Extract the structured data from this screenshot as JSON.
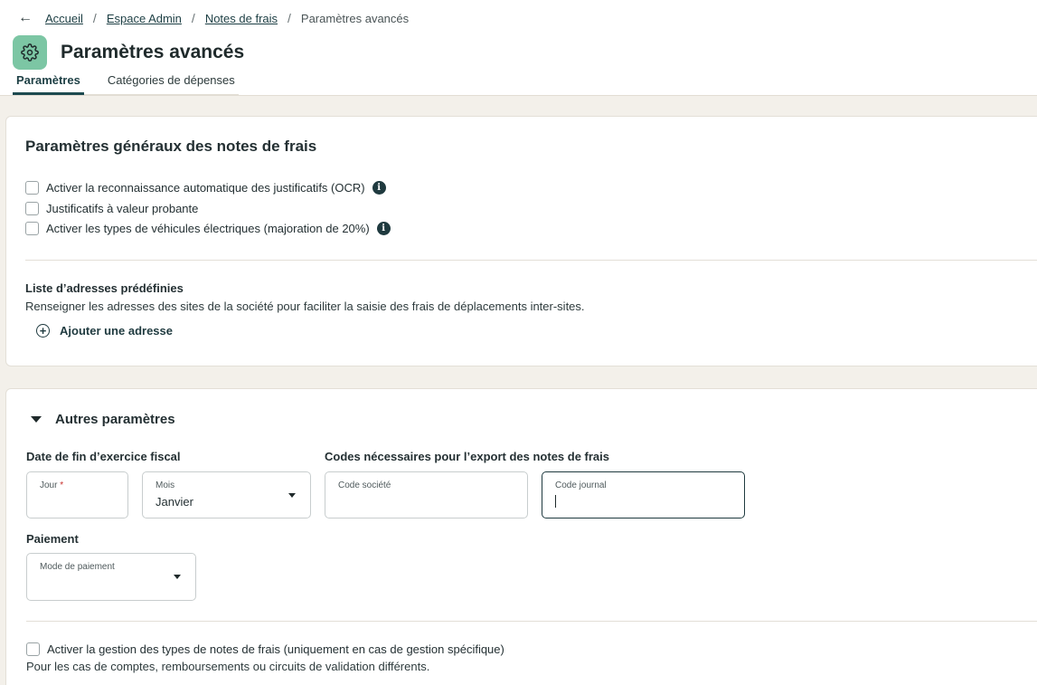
{
  "breadcrumb": {
    "back_icon": "arrow-left-icon",
    "items": [
      "Accueil",
      "Espace Admin",
      "Notes de frais"
    ],
    "current": "Paramètres avancés"
  },
  "header": {
    "icon": "gear-icon",
    "icon_bg": "#7cc6a4",
    "title": "Paramètres avancés"
  },
  "tabs": [
    {
      "label": "Paramètres",
      "active": true
    },
    {
      "label": "Catégories de dépenses",
      "active": false
    }
  ],
  "general": {
    "title": "Paramètres généraux des notes de frais",
    "options": [
      {
        "label": "Activer la reconnaissance automatique des justificatifs (OCR)",
        "checked": false,
        "info": true
      },
      {
        "label": "Justificatifs à valeur probante",
        "checked": false,
        "info": false
      },
      {
        "label": "Activer les types de véhicules électriques (majoration de 20%)",
        "checked": false,
        "info": true
      }
    ],
    "addresses": {
      "title": "Liste d’adresses prédéfinies",
      "description": "Renseigner les adresses des sites de la société pour faciliter la saisie des frais de déplacements inter-sites.",
      "add_label": "Ajouter une adresse"
    }
  },
  "other": {
    "title": "Autres paramètres",
    "fiscal": {
      "title": "Date de fin d’exercice fiscal",
      "day_label": "Jour",
      "day_required": "*",
      "day_value": "",
      "month_label": "Mois",
      "month_value": "Janvier"
    },
    "export": {
      "title": "Codes nécessaires pour l’export des notes de frais",
      "company_code_label": "Code société",
      "company_code_value": "",
      "journal_code_label": "Code journal",
      "journal_code_value": ""
    },
    "payment": {
      "title": "Paiement",
      "mode_label": "Mode de paiement",
      "mode_value": ""
    },
    "types": {
      "label": "Activer la gestion des types de notes de frais (uniquement en cas de gestion spécifique)",
      "checked": false,
      "description": "Pour les cas de comptes, remboursements ou circuits de validation différents."
    }
  },
  "colors": {
    "accent": "#1d4a50",
    "canvas": "#f3f0ea",
    "focus_border": "#1f3a3f"
  }
}
